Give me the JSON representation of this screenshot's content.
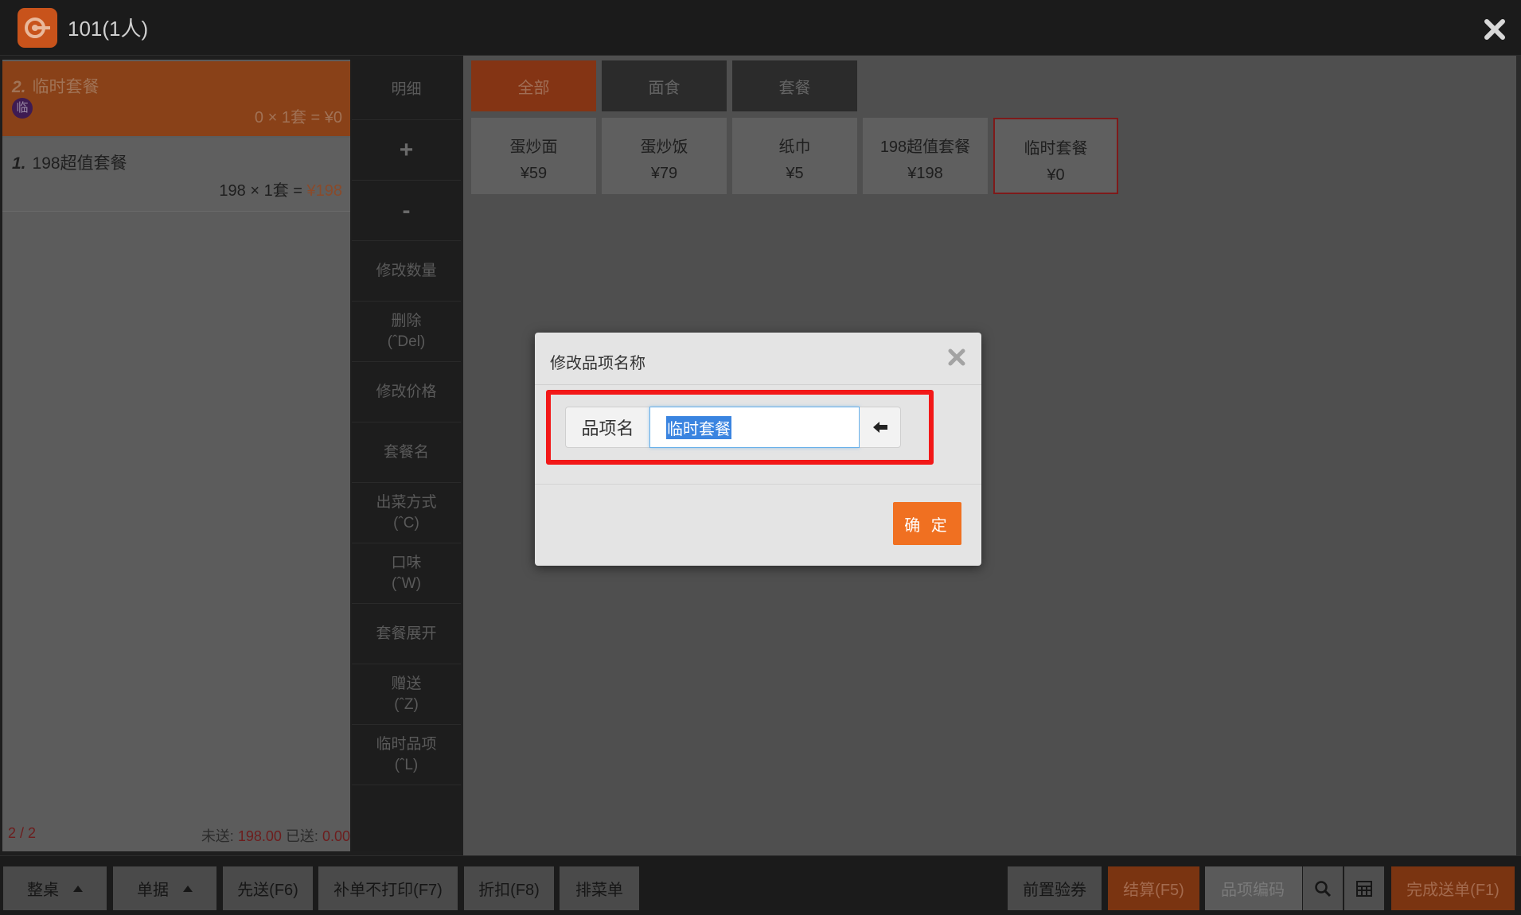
{
  "window": {
    "title": "101(1人)"
  },
  "order": {
    "items": [
      {
        "index": "2.",
        "name": "临时套餐",
        "badge": "临",
        "calc": "0 × 1套 = ¥0"
      },
      {
        "index": "1.",
        "name": "198超值套餐",
        "calc_prefix": "198 × 1套 = ",
        "price": "¥198"
      }
    ],
    "pager": "2 / 2",
    "unsent_label": "未送:",
    "unsent_value": "198.00",
    "sent_label": "已送:",
    "sent_value": "0.00"
  },
  "ops": [
    {
      "label": "明细"
    },
    {
      "label": "+"
    },
    {
      "label": "-"
    },
    {
      "label": "修改数量"
    },
    {
      "label": "删除",
      "sub": "(ˆDel)"
    },
    {
      "label": "修改价格"
    },
    {
      "label": "套餐名"
    },
    {
      "label": "出菜方式",
      "sub": "(ˆC)"
    },
    {
      "label": "口味",
      "sub": "(ˆW)"
    },
    {
      "label": "套餐展开"
    },
    {
      "label": "赠送",
      "sub": "(ˆZ)"
    },
    {
      "label": "临时品项",
      "sub": "(ˆL)"
    }
  ],
  "categories": [
    "全部",
    "面食",
    "套餐"
  ],
  "products": [
    {
      "name": "蛋炒面",
      "price": "¥59"
    },
    {
      "name": "蛋炒饭",
      "price": "¥79"
    },
    {
      "name": "纸巾",
      "price": "¥5"
    },
    {
      "name": "198超值套餐",
      "price": "¥198"
    },
    {
      "name": "临时套餐",
      "price": "¥0"
    }
  ],
  "toolbar": {
    "whole_table": "整桌",
    "bill": "单据",
    "send_first": "先送(F6)",
    "supplement_no_print": "补单不打印(F7)",
    "discount": "折扣(F8)",
    "menu_order": "排菜单",
    "pre_coupon": "前置验券",
    "settle": "结算(F5)",
    "item_code_placeholder": "品项编码",
    "finish_send": "完成送单(F1)"
  },
  "dialog": {
    "title": "修改品项名称",
    "field_label": "品项名",
    "field_value": "临时套餐",
    "ok": "确 定"
  },
  "colors": {
    "accent": "#f07021",
    "highlight_border": "#f21818",
    "selection": "#3a84e0"
  }
}
